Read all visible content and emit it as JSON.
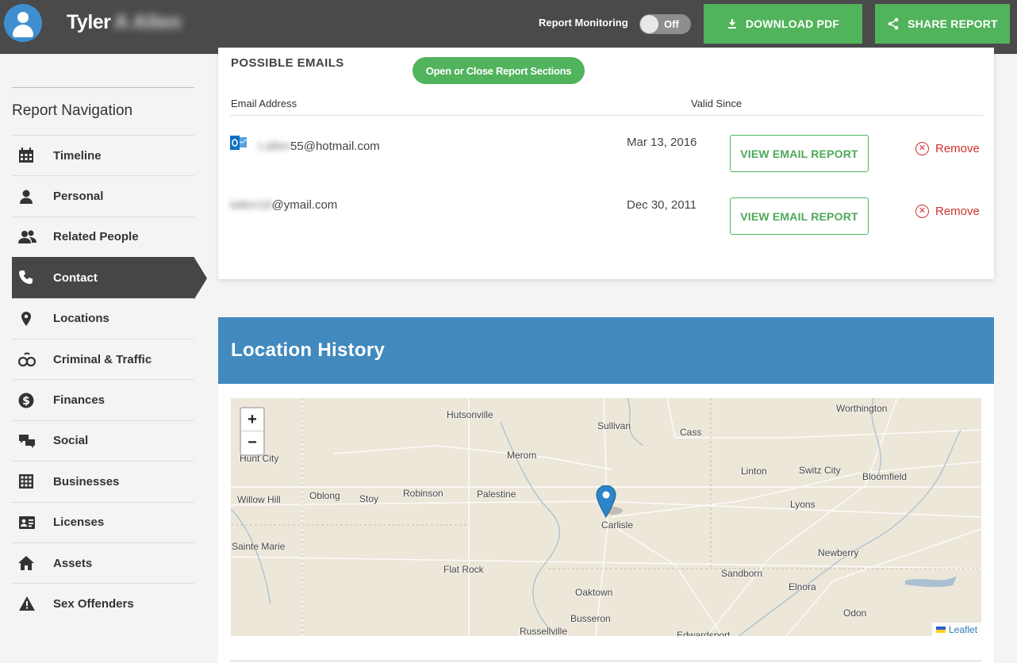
{
  "header": {
    "user_first": "Tyler",
    "user_last": "A Allen",
    "monitoring_label": "Report Monitoring",
    "monitoring_state": "Off",
    "download_label": "DOWNLOAD PDF",
    "share_label": "SHARE REPORT"
  },
  "nav": {
    "title": "Report Navigation",
    "items": [
      {
        "label": "Timeline",
        "icon": "calendar-icon"
      },
      {
        "label": "Personal",
        "icon": "person-icon"
      },
      {
        "label": "Related People",
        "icon": "people-icon"
      },
      {
        "label": "Contact",
        "icon": "phone-icon",
        "active": true
      },
      {
        "label": "Locations",
        "icon": "map-pin-icon"
      },
      {
        "label": "Criminal & Traffic",
        "icon": "handcuffs-icon"
      },
      {
        "label": "Finances",
        "icon": "dollar-icon"
      },
      {
        "label": "Social",
        "icon": "chat-icon"
      },
      {
        "label": "Businesses",
        "icon": "building-icon"
      },
      {
        "label": "Licenses",
        "icon": "id-card-icon"
      },
      {
        "label": "Assets",
        "icon": "home-icon"
      },
      {
        "label": "Sex Offenders",
        "icon": "warning-icon"
      }
    ]
  },
  "emails": {
    "section_title": "POSSIBLE EMAILS",
    "toggle_label": "Open or Close Report Sections",
    "col_address": "Email Address",
    "col_valid": "Valid Since",
    "rows": [
      {
        "local_hidden": "t.allen",
        "visible": "55@hotmail.com",
        "date": "Mar 13, 2016",
        "action": "VIEW EMAIL REPORT",
        "remove": "Remove"
      },
      {
        "local_hidden": "tallen18",
        "visible": "@ymail.com",
        "date": "Dec 30, 2011",
        "action": "VIEW EMAIL REPORT",
        "remove": "Remove"
      }
    ]
  },
  "location": {
    "title": "Location History",
    "map_places": [
      "Hutsonville",
      "Sullivan",
      "Cass",
      "Worthington",
      "Hunt City",
      "Merom",
      "Linton",
      "Switz City",
      "Bloomfield",
      "Willow Hill",
      "Oblong",
      "Stoy",
      "Robinson",
      "Palestine",
      "Lyons",
      "Carlisle",
      "Sainte Marie",
      "Newberry",
      "Flat Rock",
      "Sandborn",
      "Oaktown",
      "Elnora",
      "Busseron",
      "Odon",
      "Russellville",
      "Edwardsport"
    ],
    "zoom_in": "+",
    "zoom_out": "−",
    "attribution": "Leaflet"
  }
}
